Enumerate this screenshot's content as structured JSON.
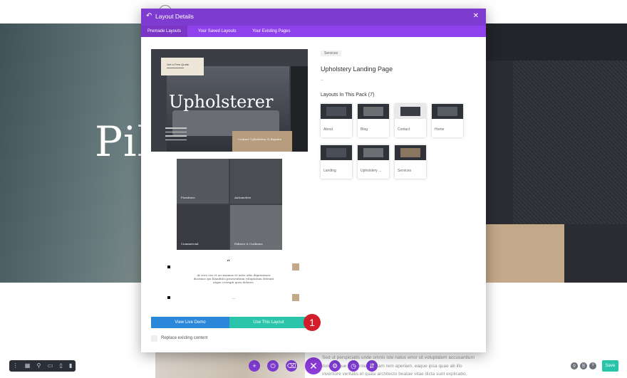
{
  "background": {
    "hero_word": "Pill",
    "lower_text": "Sed ut perspiciatis unde omnis iste natus error sit voluptatem accusantium doloremque laudantium, totam rem aperiam, eaque ipsa quae ab illo inventore veritatis et quasi architecto beatae vitae dicta sunt explicabo."
  },
  "builder": {
    "left_toolbar_icons": [
      "menu-icon",
      "wireframe-icon",
      "zoom-icon",
      "desktop-icon",
      "tablet-icon",
      "phone-icon"
    ],
    "center_buttons": [
      "add-icon",
      "power-icon",
      "trash-icon",
      "close-icon",
      "gear-icon",
      "history-icon",
      "portability-icon"
    ],
    "right_buttons": [
      "search-icon",
      "layers-icon",
      "help-icon"
    ],
    "save_label": "Save"
  },
  "modal": {
    "title": "Layout Details",
    "tabs": [
      "Premade Layouts",
      "Your Saved Layouts",
      "Your Existing Pages"
    ],
    "active_tab": 0,
    "preview": {
      "quote_label": "Get a Free Quote",
      "hero_title": "Upholsterer",
      "contact_text": "Contact Upholstery & Repairs",
      "grid_labels": [
        "Furniture",
        "Automotive",
        "Commercial",
        "Fabrics & Cushions"
      ],
      "quote_mark": "“",
      "testimonial": "At vero eos et accusamus et iusto odio dignissimos ducimus qui blanditiis praesentium voluptatum deleniti atque corrupti quos dolores.",
      "testimonial_author": "—"
    },
    "view_demo_label": "View Live Demo",
    "use_layout_label": "Use This Layout",
    "step_badge": "1",
    "replace_label": "Replace existing content",
    "category_tag": "Services",
    "layout_name": "Upholstery Landing Page",
    "separator": "–",
    "pack_heading": "Layouts In This Pack (7)",
    "pack_layouts": [
      "About",
      "Blog",
      "Contact",
      "Home",
      "Landing",
      "Upholstery ...",
      "Services"
    ]
  },
  "colors": {
    "purple": "#7e3bd0",
    "tab_purple": "#8f42ec",
    "blue": "#2b87da",
    "teal": "#29c4a9",
    "badge_red": "#d31d28"
  }
}
